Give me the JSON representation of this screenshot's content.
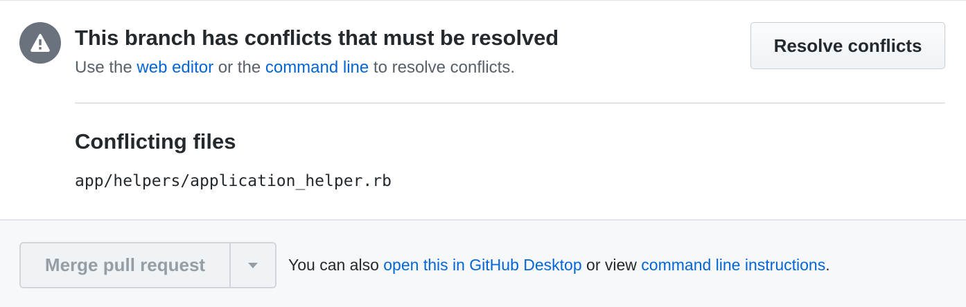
{
  "conflict": {
    "icon": "alert-icon",
    "title": "This branch has conflicts that must be resolved",
    "subtitle": {
      "prefix": "Use the ",
      "web_editor_link": "web editor",
      "middle": " or the ",
      "command_line_link": "command line",
      "suffix": " to resolve conflicts."
    },
    "resolve_button": "Resolve conflicts",
    "files_heading": "Conflicting files",
    "files": [
      "app/helpers/application_helper.rb"
    ]
  },
  "merge": {
    "button_label": "Merge pull request",
    "dropdown_icon": "triangle-down-icon",
    "note": {
      "prefix": "You can also ",
      "desktop_link": "open this in GitHub Desktop",
      "middle": " or view ",
      "instructions_link": "command line instructions",
      "suffix": "."
    }
  },
  "colors": {
    "link": "#0366d6",
    "badge": "#6a737d",
    "muted_text": "#586069",
    "disabled_text": "#959da5",
    "footer_bg": "#f6f8fa"
  }
}
